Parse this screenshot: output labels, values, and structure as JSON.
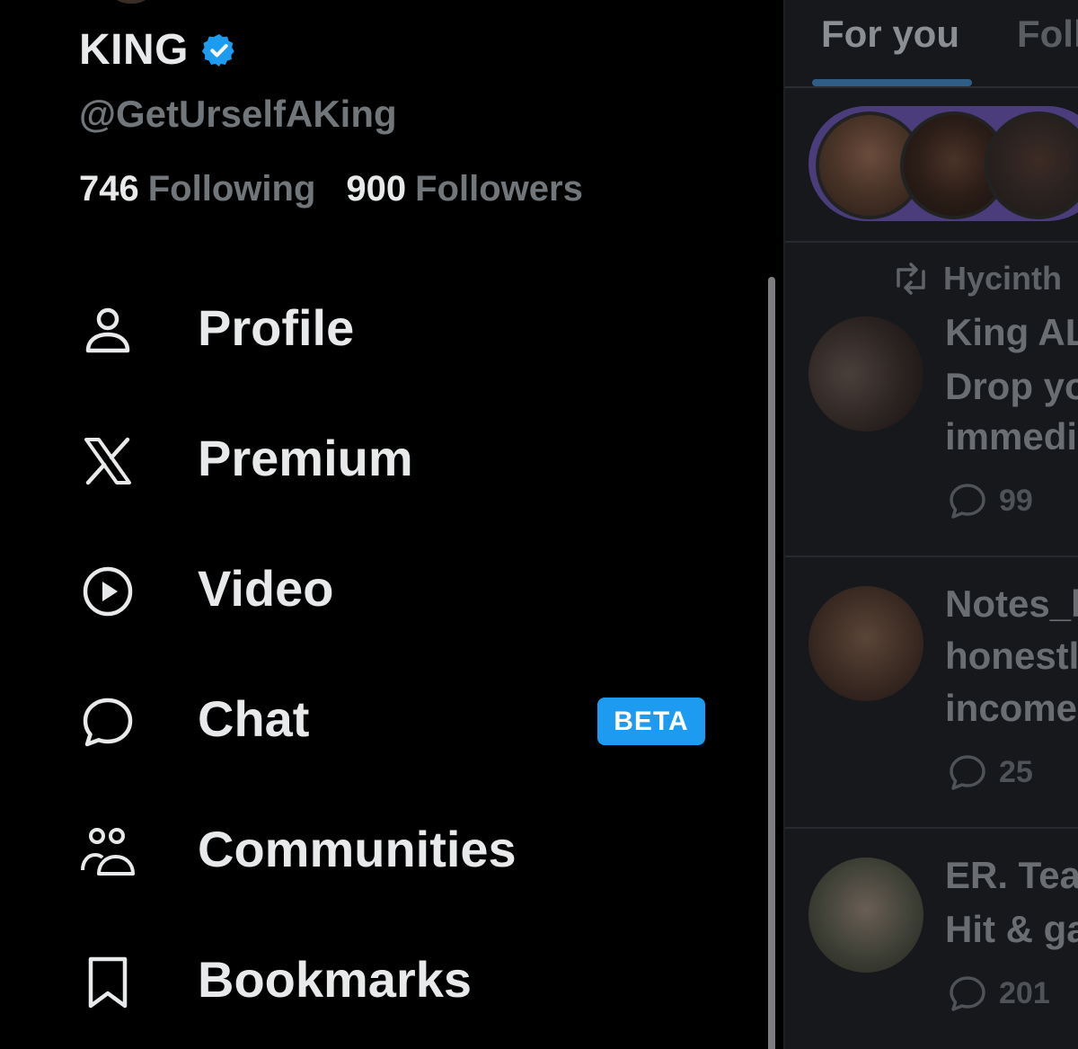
{
  "account": {
    "name": "KING",
    "handle": "@GetUrselfAKing",
    "following_count": "746",
    "following_label": "Following",
    "followers_count": "900",
    "followers_label": "Followers"
  },
  "menu": {
    "items": [
      {
        "label": "Profile",
        "icon": "person-icon"
      },
      {
        "label": "Premium",
        "icon": "x-logo-icon"
      },
      {
        "label": "Video",
        "icon": "play-circle-icon"
      },
      {
        "label": "Chat",
        "icon": "chat-bubble-icon",
        "badge": "BETA"
      },
      {
        "label": "Communities",
        "icon": "communities-icon"
      },
      {
        "label": "Bookmarks",
        "icon": "bookmark-icon"
      }
    ]
  },
  "timeline": {
    "tabs": [
      {
        "label": "For you"
      },
      {
        "label": "Foll"
      }
    ],
    "posts": [
      {
        "repost_by": "Hycinth",
        "lines": [
          "King AL",
          "Drop yo",
          "immedi"
        ],
        "replies": "99"
      },
      {
        "lines": [
          "Notes_b",
          "honestl",
          "income"
        ],
        "replies": "25"
      },
      {
        "lines": [
          "ER. Tea",
          "Hit & ga"
        ],
        "replies": "201"
      }
    ]
  },
  "colors": {
    "accent": "#1d9bf0",
    "background": "#000000",
    "muted_text": "#71767b",
    "spaces_bar": "#4b3d7c"
  }
}
